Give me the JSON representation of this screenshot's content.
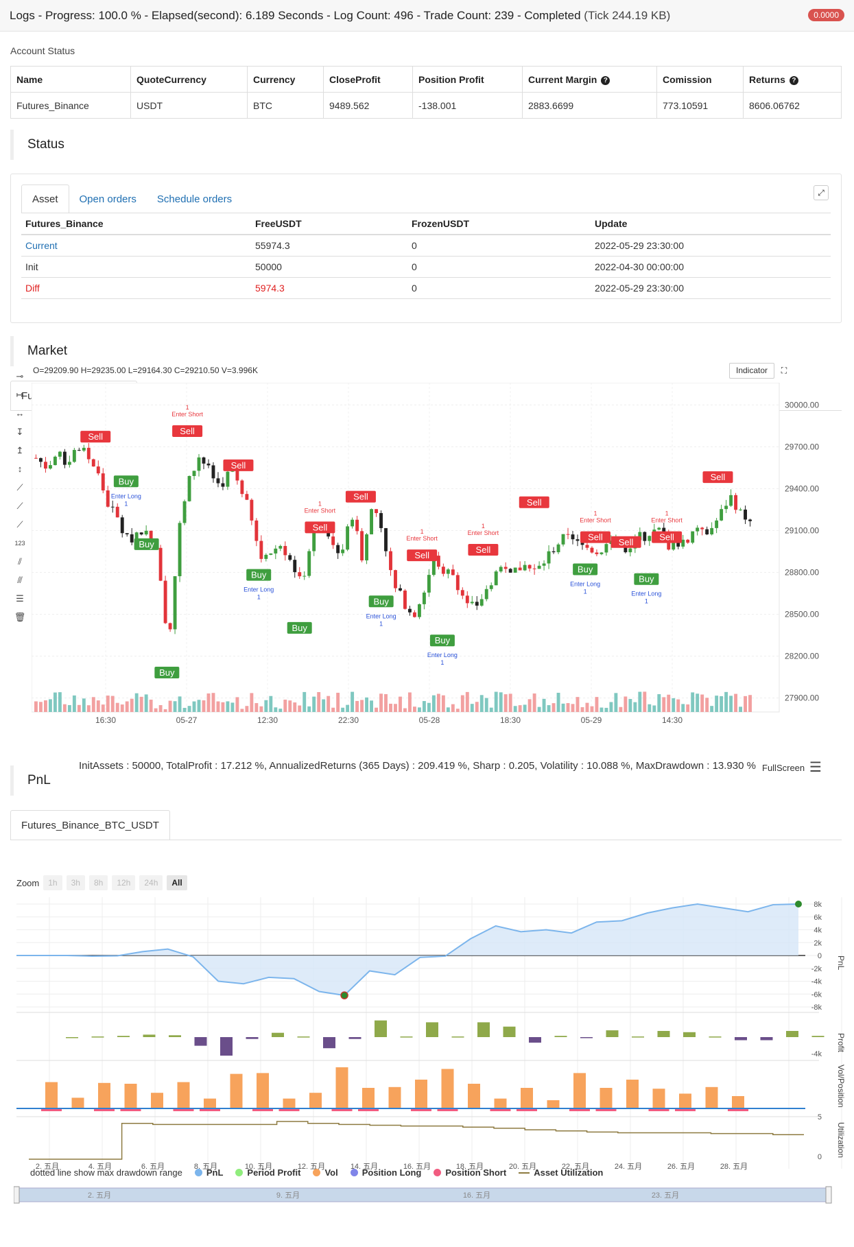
{
  "logs": {
    "title": "Logs - Progress: 100.0 % - Elapsed(second): 6.189 Seconds - Log Count: 496 - Trade Count: 239 - Completed",
    "tick": "(Tick 244.19 KB)",
    "badge": "0.0000"
  },
  "account": {
    "label": "Account Status",
    "headers": [
      "Name",
      "QuoteCurrency",
      "Currency",
      "CloseProfit",
      "Position Profit",
      "Current Margin",
      "Comission",
      "Returns"
    ],
    "row": [
      "Futures_Binance",
      "USDT",
      "BTC",
      "9489.562",
      "-138.001",
      "2883.6699",
      "773.10591",
      "8606.06762"
    ]
  },
  "status": {
    "title": "Status",
    "tabs": [
      "Asset",
      "Open orders",
      "Schedule orders"
    ],
    "headers": [
      "Futures_Binance",
      "FreeUSDT",
      "FrozenUSDT",
      "Update"
    ],
    "rows": [
      [
        "Current",
        "55974.3",
        "0",
        "2022-05-29 23:30:00"
      ],
      [
        "Init",
        "50000",
        "0",
        "2022-04-30 00:00:00"
      ],
      [
        "Diff",
        "5974.3",
        "0",
        "2022-05-29 23:30:00"
      ]
    ]
  },
  "market": {
    "title": "Market",
    "tab": "Futures_Binance:swap",
    "ohlc": "O=29209.90  H=29235.00  L=29164.30  C=29210.50  V=3.996K",
    "indicator_label": "Indicator"
  },
  "pnl": {
    "title": "PnL",
    "tab": "Futures_Binance_BTC_USDT",
    "summary": "InitAssets : 50000, TotalProfit : 17.212 %, AnnualizedReturns (365 Days) : 209.419 %, Sharp : 0.205, Volatility : 10.088 %, MaxDrawdown : 13.930 %",
    "fullscreen": "FullScreen",
    "zoom_label": "Zoom",
    "zoom_buttons": [
      "1h",
      "3h",
      "8h",
      "12h",
      "24h",
      "All"
    ],
    "legend_note": "dotted line show max drawdown range",
    "legend": [
      "PnL",
      "Period Profit",
      "Vol",
      "Position Long",
      "Position Short",
      "Asset Utilization"
    ]
  },
  "chart_data": [
    {
      "type": "candlestick",
      "title": "",
      "x_ticks": [
        "16:30",
        "05-27",
        "12:30",
        "22:30",
        "05-28",
        "18:30",
        "05-29",
        "14:30"
      ],
      "y_ticks": [
        30000.0,
        29700.0,
        29400.0,
        29100.0,
        28800.0,
        28500.0,
        28200.0,
        27900.0
      ],
      "ylim": [
        27800,
        30100
      ],
      "close_path": [
        29620,
        29560,
        29640,
        29590,
        29700,
        29640,
        29520,
        29300,
        29180,
        29020,
        29100,
        29080,
        28900,
        28250,
        29100,
        29450,
        29640,
        29520,
        29420,
        29520,
        29440,
        29200,
        28900,
        28950,
        29000,
        28900,
        28700,
        29050,
        29150,
        29000,
        28950,
        29220,
        28900,
        29300,
        29100,
        28700,
        28600,
        28500,
        28650,
        28900,
        28820,
        28780,
        28600,
        28550,
        28650,
        28800,
        28850,
        28820,
        28850,
        28800,
        28900,
        29000,
        29050,
        29000,
        28980,
        28950,
        29000,
        29050,
        28900,
        29050,
        29080,
        29100,
        29000,
        29020,
        29050,
        29150,
        29100,
        29200,
        29350,
        29250,
        29150
      ],
      "annotations": [
        {
          "text": "Sell",
          "color": "red",
          "x": 6,
          "y": 29770
        },
        {
          "text": "Sell",
          "color": "red",
          "x": 15,
          "y": 29810,
          "sub": "Enter Short",
          "qty": "1"
        },
        {
          "text": "Sell",
          "color": "red",
          "x": 20,
          "y": 29565
        },
        {
          "text": "Buy",
          "color": "green",
          "x": 9,
          "y": 29450,
          "sub": "Enter Long",
          "qty": "1"
        },
        {
          "text": "Buy",
          "color": "green",
          "x": 11,
          "y": 29000
        },
        {
          "text": "Buy",
          "color": "green",
          "x": 13,
          "y": 28080
        },
        {
          "text": "Sell",
          "color": "red",
          "x": 28,
          "y": 29120,
          "sub": "Enter Short",
          "qty": "1"
        },
        {
          "text": "Sell",
          "color": "red",
          "x": 32,
          "y": 29340
        },
        {
          "text": "Buy",
          "color": "green",
          "x": 22,
          "y": 28780,
          "sub": "Enter Long",
          "qty": "1"
        },
        {
          "text": "Buy",
          "color": "green",
          "x": 26,
          "y": 28400
        },
        {
          "text": "Sell",
          "color": "red",
          "x": 38,
          "y": 28920,
          "sub": "Enter Short",
          "qty": "1"
        },
        {
          "text": "Sell",
          "color": "red",
          "x": 44,
          "y": 28960,
          "sub": "Enter Short",
          "qty": "1"
        },
        {
          "text": "Buy",
          "color": "green",
          "x": 34,
          "y": 28590,
          "sub": "Enter Long",
          "qty": "1"
        },
        {
          "text": "Buy",
          "color": "green",
          "x": 40,
          "y": 28310,
          "sub": "Enter Long",
          "qty": "1"
        },
        {
          "text": "Sell",
          "color": "red",
          "x": 49,
          "y": 29300
        },
        {
          "text": "Sell",
          "color": "red",
          "x": 55,
          "y": 29050,
          "sub": "Enter Short",
          "qty": "1"
        },
        {
          "text": "Sell",
          "color": "red",
          "x": 58,
          "y": 29015
        },
        {
          "text": "Sell",
          "color": "red",
          "x": 62,
          "y": 29050,
          "sub": "Enter Short",
          "qty": "1"
        },
        {
          "text": "Buy",
          "color": "green",
          "x": 54,
          "y": 28820,
          "sub": "Enter Long",
          "qty": "1"
        },
        {
          "text": "Buy",
          "color": "green",
          "x": 60,
          "y": 28750,
          "sub": "Enter Long",
          "qty": "1"
        },
        {
          "text": "Sell",
          "color": "red",
          "x": 67,
          "y": 29480
        }
      ]
    },
    {
      "type": "area",
      "ylabel": "PnL",
      "y_ticks": [
        "8k",
        "6k",
        "4k",
        "2k",
        "0",
        "-2k",
        "-4k",
        "-6k",
        "-8k"
      ],
      "ylim": [
        -8,
        8
      ],
      "values": [
        0,
        0,
        0,
        -0.1,
        -0.05,
        0.6,
        1.0,
        -0.2,
        -4.0,
        -4.4,
        -3.4,
        -3.6,
        -5.6,
        -6.2,
        -2.4,
        -3.0,
        -0.3,
        -0.1,
        2.6,
        4.6,
        3.7,
        4.0,
        3.5,
        5.2,
        5.4,
        6.6,
        7.4,
        8.0,
        7.4,
        6.8,
        7.9,
        8.0
      ]
    },
    {
      "type": "bar",
      "ylabel": "Profit",
      "y_ticks": [
        "-4k"
      ],
      "values": [
        0,
        0.1,
        0.2,
        0.4,
        0.3,
        -1.4,
        -3.0,
        -0.3,
        0.7,
        0.1,
        -1.8,
        -0.3,
        2.7,
        0.1,
        2.4,
        0.1,
        2.4,
        1.7,
        -0.9,
        0.2,
        -0.1,
        1.1,
        0.1,
        1.0,
        0.8,
        0.1,
        -0.5,
        -0.5,
        1.0,
        0.2
      ]
    },
    {
      "type": "bar",
      "ylabel": "Vol/Position",
      "y_ticks": [
        "5"
      ],
      "values": [
        3.2,
        1.3,
        3.1,
        3.0,
        1.9,
        3.2,
        1.2,
        4.2,
        4.3,
        1.2,
        1.9,
        5.0,
        2.5,
        2.6,
        3.5,
        4.8,
        3.0,
        1.2,
        2.5,
        1.0,
        4.3,
        2.5,
        3.5,
        2.4,
        1.8,
        2.6,
        1.5
      ]
    },
    {
      "type": "line",
      "ylabel": "Utilization",
      "y_ticks": [
        "0"
      ],
      "x_ticks": [
        "2. 五月",
        "4. 五月",
        "6. 五月",
        "8. 五月",
        "10. 五月",
        "12. 五月",
        "14. 五月",
        "16. 五月",
        "18. 五月",
        "20. 五月",
        "22. 五月",
        "24. 五月",
        "26. 五月",
        "28. 五月"
      ],
      "values": [
        0,
        0,
        0,
        0.95,
        0.92,
        0.92,
        0.92,
        0.92,
        1.0,
        0.95,
        0.92,
        0.9,
        0.88,
        0.88,
        0.85,
        0.82,
        0.78,
        0.75,
        0.72,
        0.7,
        0.7,
        0.7,
        0.68,
        0.68,
        0.65,
        0.65
      ]
    }
  ],
  "navigator_ticks": [
    "2. 五月",
    "9. 五月",
    "16. 五月",
    "23. 五月"
  ]
}
